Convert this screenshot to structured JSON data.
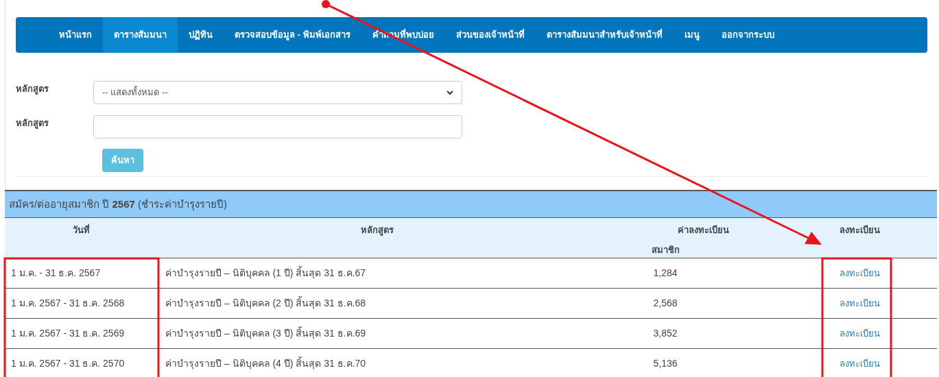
{
  "nav": [
    {
      "label": "หน้าแรก",
      "selected": false
    },
    {
      "label": "ตารางสัมมนา",
      "selected": true
    },
    {
      "label": "ปฏิทิน",
      "selected": false
    },
    {
      "label": "ตรวจสอบข้อมูล - พิมพ์เอกสาร",
      "selected": false
    },
    {
      "label": "คำถามที่พบบ่อย",
      "selected": false
    },
    {
      "label": "ส่วนของเจ้าหน้าที่",
      "selected": false
    },
    {
      "label": "ตารางสัมมนาสำหรับเจ้าหน้าที่",
      "selected": false
    },
    {
      "label": "เมนู",
      "selected": false
    },
    {
      "label": "ออกจากระบบ",
      "selected": false
    }
  ],
  "filters": [
    {
      "kind": "select",
      "label": "หลักสูตร",
      "value": "-- แสดงทั้งหมด --"
    },
    {
      "kind": "text",
      "label": "หลักสูตร"
    }
  ],
  "search_button": "ค้นหา",
  "table": {
    "title": "สมัคร/ต่ออายุสมาชิก ปี **2567** (ชำระค่าบำรุงรายปี)",
    "columns": [
      {
        "label": "วันที่",
        "highlighted": true
      },
      {
        "label": "หลักสูตร",
        "highlighted": false
      },
      {
        "label": "ค่าลงทะเบียน",
        "sublabel": "สมาชิก",
        "highlighted": false
      },
      {
        "label": "ลงทะเบียน",
        "highlighted": true
      }
    ],
    "rows": [
      {
        "date": "1 ม.ค. - 31 ธ.ค. 2567",
        "course": "ค่าบำรุงรายปี – นิติบุคคล (1 ปี) สิ้นสุด 31 ธ.ค.67",
        "fee": "1,284",
        "action": "ลงทะเบียน"
      },
      {
        "date": "1 ม.ค. 2567 - 31 ธ.ค. 2568",
        "course": "ค่าบำรุงรายปี – นิติบุคคล (2 ปี) สิ้นสุด 31 ธ.ค.68",
        "fee": "2,568",
        "action": "ลงทะเบียน"
      },
      {
        "date": "1 ม.ค. 2567 - 31 ธ.ค. 2569",
        "course": "ค่าบำรุงรายปี – นิติบุคคล (3 ปี) สิ้นสุด 31 ธ.ค.69",
        "fee": "3,852",
        "action": "ลงทะเบียน"
      },
      {
        "date": "1 ม.ค. 2567 - 31 ธ.ค. 2570",
        "course": "ค่าบำรุงรายปี – นิติบุคคล (4 ปี) สิ้นสุด 31 ธ.ค.70",
        "fee": "5,136",
        "action": "ลงทะเบียน"
      }
    ]
  },
  "pointer_arrow": true
}
